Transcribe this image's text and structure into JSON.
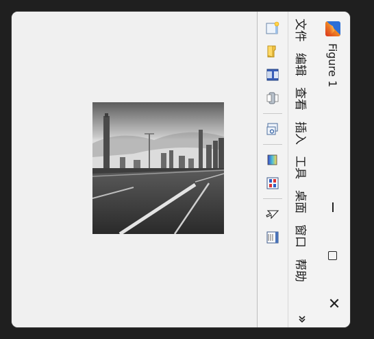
{
  "window": {
    "title": "Figure 1",
    "controls": {
      "minimize_icon": "minimize-icon",
      "maximize_icon": "maximize-icon",
      "close_label": "✕"
    }
  },
  "menubar": {
    "items": [
      {
        "label": "文件"
      },
      {
        "label": "编辑"
      },
      {
        "label": "查看"
      },
      {
        "label": "插入"
      },
      {
        "label": "工具"
      },
      {
        "label": "桌面"
      },
      {
        "label": "窗口"
      },
      {
        "label": "帮助"
      }
    ],
    "overflow_icon": "chevron-double-icon"
  },
  "toolbar": {
    "buttons": [
      {
        "icon": "new-figure-icon"
      },
      {
        "icon": "open-folder-icon"
      },
      {
        "icon": "save-icon"
      },
      {
        "icon": "print-icon"
      },
      {
        "icon": "link-plot-icon"
      },
      {
        "icon": "colorbar-icon"
      },
      {
        "icon": "legend-icon"
      },
      {
        "icon": "edit-plot-arrow-icon"
      },
      {
        "icon": "property-inspector-icon"
      }
    ]
  },
  "figure": {
    "image_description_icon": "highway-skyline-photo"
  },
  "colors": {
    "window_bg": "#f0f0f0",
    "outer_bg": "#1f1f1f"
  }
}
